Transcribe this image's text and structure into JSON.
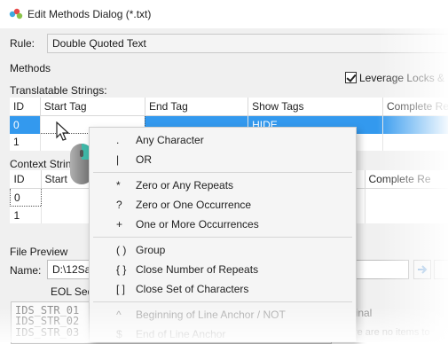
{
  "window": {
    "title": "Edit Methods Dialog (*.txt)"
  },
  "rule": {
    "label": "Rule:",
    "value": "Double Quoted Text"
  },
  "methods": {
    "label": "Methods",
    "leverage_label": "Leverage Locks & M",
    "translatable": {
      "label": "Translatable Strings:",
      "headers": [
        "ID",
        "Start Tag",
        "End Tag",
        "Show Tags",
        "Complete Re"
      ],
      "rows": [
        {
          "id": "0",
          "show_tags": "HIDE"
        },
        {
          "id": "1"
        }
      ]
    },
    "context": {
      "label": "Context String",
      "headers": [
        "ID",
        "Start",
        "Complete Re"
      ],
      "rows": [
        {
          "id": "0"
        },
        {
          "id": "1"
        }
      ]
    }
  },
  "file_preview": {
    "label": "File Preview",
    "name_label": "Name:",
    "name_value": "D:\\12Sa",
    "eol_label": "EOL Seq",
    "lines": [
      "IDS_STR_01",
      "IDS_STR_02",
      "IDS_STR_03"
    ],
    "original_header": "Original",
    "empty_text": "There are no items to"
  },
  "context_menu": {
    "items": [
      {
        "symbol": ".",
        "label": "Any Character"
      },
      {
        "symbol": "|",
        "label": "OR"
      },
      {
        "symbol": "*",
        "label": "Zero or Any Repeats"
      },
      {
        "symbol": "?",
        "label": "Zero or One Occurrence"
      },
      {
        "symbol": "+",
        "label": "One or More Occurrences"
      },
      {
        "symbol": "( )",
        "label": "Group"
      },
      {
        "symbol": "{ }",
        "label": "Close Number of Repeats"
      },
      {
        "symbol": "[ ]",
        "label": "Close Set of Characters"
      },
      {
        "symbol": "^",
        "label": "Beginning of Line Anchor / NOT"
      },
      {
        "symbol": "$",
        "label": "End of Line Anchor"
      }
    ]
  },
  "colors": {
    "selection": "#3399ee",
    "accent_mouse": "#3fb8a8"
  }
}
